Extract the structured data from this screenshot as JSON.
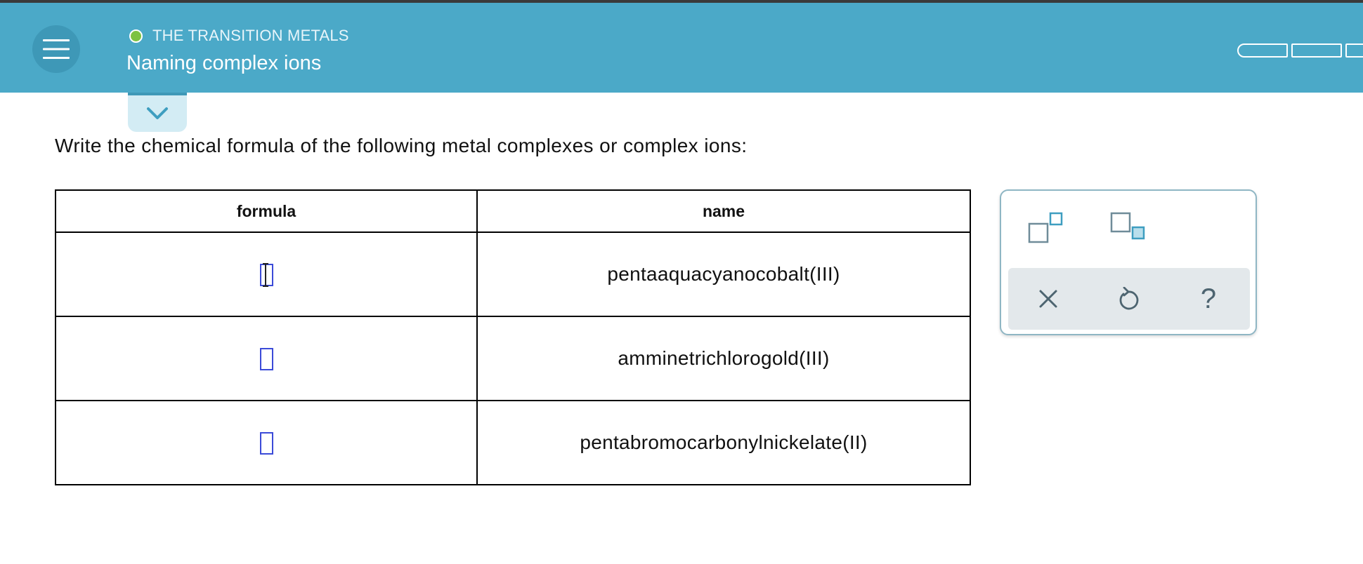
{
  "header": {
    "subject": "THE TRANSITION METALS",
    "topic": "Naming complex ions",
    "status_color": "#7cc242",
    "accent_color": "#4ba9c8",
    "progress_segments": 3
  },
  "question": {
    "instructions": "Write the chemical formula of the following metal complexes or complex ions:"
  },
  "table": {
    "headers": {
      "formula": "formula",
      "name": "name"
    },
    "rows": [
      {
        "name": "pentaaquacyanocobalt(III)",
        "formula_value": ""
      },
      {
        "name": "amminetrichlorogold(III)",
        "formula_value": ""
      },
      {
        "name": "pentabromocarbonylnickelate(II)",
        "formula_value": ""
      }
    ]
  },
  "tools": {
    "superscript_icon": "superscript-icon",
    "subscript_icon": "subscript-icon",
    "clear_icon": "close-icon",
    "undo_icon": "undo-icon",
    "help_icon": "help-icon",
    "help_label": "?"
  }
}
